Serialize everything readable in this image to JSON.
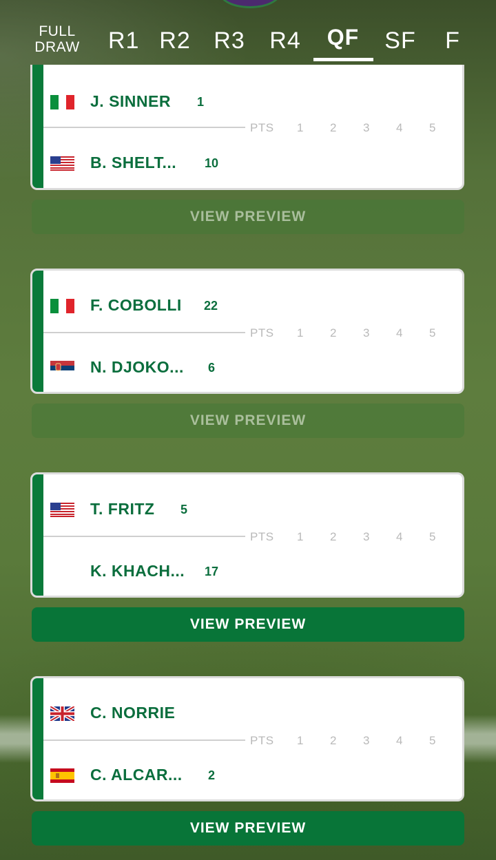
{
  "tabs": [
    {
      "label_1": "FULL",
      "label_2": "DRAW"
    },
    {
      "label": "R1"
    },
    {
      "label": "R2"
    },
    {
      "label": "R3"
    },
    {
      "label": "R4"
    },
    {
      "label": "QF"
    },
    {
      "label": "SF"
    },
    {
      "label": "F"
    }
  ],
  "active_tab": "QF",
  "score_header": {
    "pts": "PTS",
    "sets": [
      "1",
      "2",
      "3",
      "4",
      "5"
    ]
  },
  "matches": [
    {
      "p1": {
        "name": "J. SINNER",
        "seed": "1",
        "flag": "italy-flag"
      },
      "p2": {
        "name": "B. SHELT...",
        "seed": "10",
        "flag": "usa-flag"
      },
      "preview_label": "VIEW PREVIEW",
      "preview_enabled": false
    },
    {
      "p1": {
        "name": "F. COBOLLI",
        "seed": "22",
        "flag": "italy-flag"
      },
      "p2": {
        "name": "N. DJOKO...",
        "seed": "6",
        "flag": "serbia-flag"
      },
      "preview_label": "VIEW PREVIEW",
      "preview_enabled": false
    },
    {
      "p1": {
        "name": "T. FRITZ",
        "seed": "5",
        "flag": "usa-flag"
      },
      "p2": {
        "name": "K. KHACH...",
        "seed": "17",
        "flag": ""
      },
      "preview_label": "VIEW PREVIEW",
      "preview_enabled": true
    },
    {
      "p1": {
        "name": "C. NORRIE",
        "seed": "",
        "flag": "uk-flag"
      },
      "p2": {
        "name": "C. ALCAR...",
        "seed": "2",
        "flag": "spain-flag"
      },
      "preview_label": "VIEW PREVIEW",
      "preview_enabled": true
    }
  ],
  "colors": {
    "accent_green": "#0a7a3a",
    "name_green": "#0b6e3d",
    "button_green": "#087538"
  }
}
